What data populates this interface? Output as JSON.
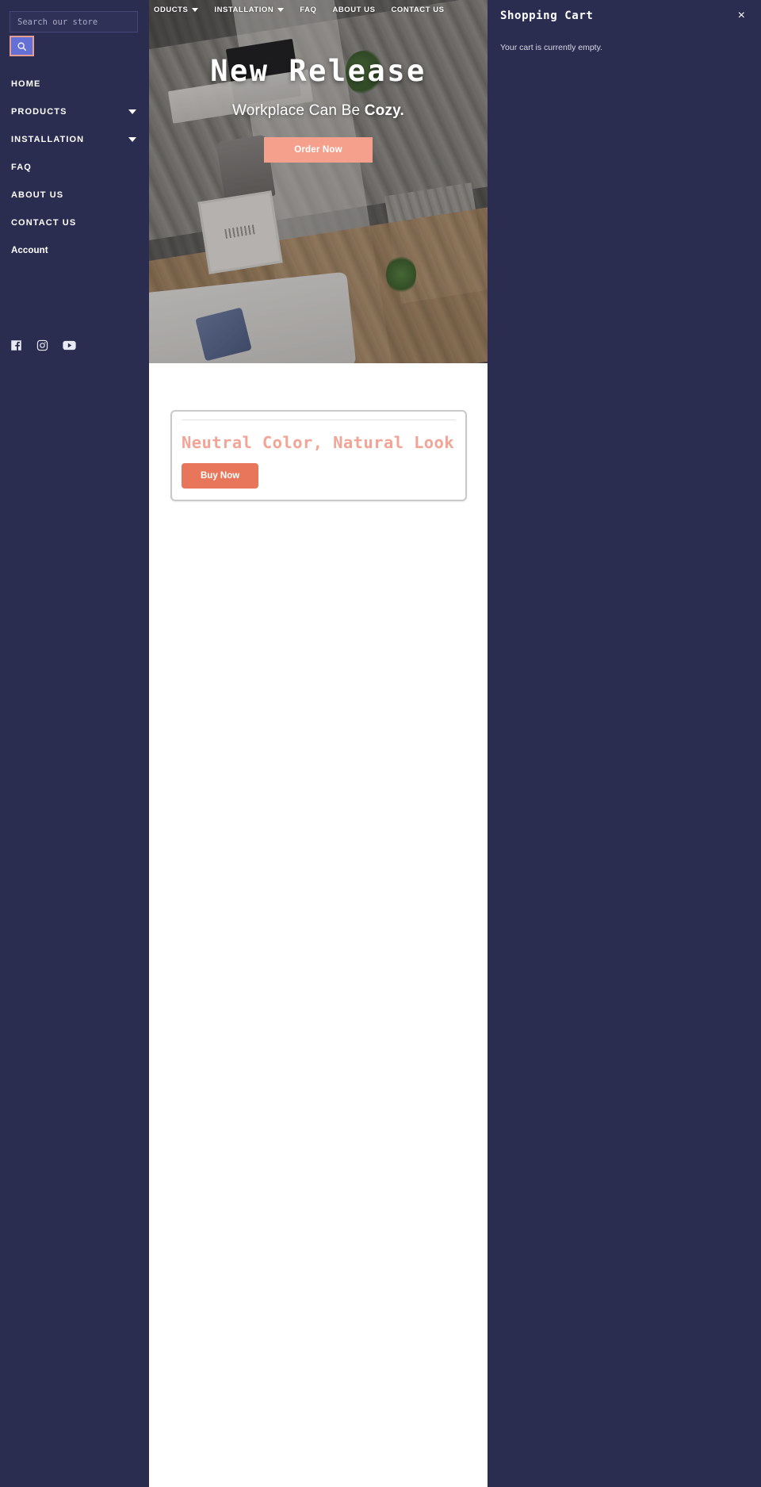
{
  "sidebar": {
    "search": {
      "placeholder": "Search our store",
      "value": "",
      "button_icon": "search-icon"
    },
    "items": [
      {
        "label": "HOME",
        "has_caret": false
      },
      {
        "label": "PRODUCTS",
        "has_caret": true
      },
      {
        "label": "INSTALLATION",
        "has_caret": true
      },
      {
        "label": "FAQ",
        "has_caret": false
      },
      {
        "label": "ABOUT US",
        "has_caret": false
      },
      {
        "label": "CONTACT US",
        "has_caret": false
      },
      {
        "label": "Account",
        "has_caret": false
      }
    ],
    "socials": [
      {
        "name": "facebook-icon"
      },
      {
        "name": "instagram-icon"
      },
      {
        "name": "youtube-icon"
      }
    ]
  },
  "topnav": {
    "items": [
      {
        "label": "ODUCTS",
        "has_caret": true
      },
      {
        "label": "INSTALLATION",
        "has_caret": true
      },
      {
        "label": "FAQ",
        "has_caret": false
      },
      {
        "label": "ABOUT US",
        "has_caret": false
      },
      {
        "label": "CONTACT US",
        "has_caret": false
      }
    ]
  },
  "hero": {
    "title": "New Release",
    "subtitle_plain": "Workplace Can Be ",
    "subtitle_bold": "Cozy.",
    "cta_label": "Order Now"
  },
  "product_card": {
    "title": "Neutral Color, Natural Look",
    "cta_label": "Buy Now"
  },
  "cart": {
    "title": "Shopping Cart",
    "close_label": "×",
    "empty_message": "Your cart is currently empty."
  },
  "colors": {
    "sidebar_bg": "#2a2d4f",
    "accent_coral": "#e8765a",
    "accent_salmon": "#f4a08c",
    "card_title": "#f2a496",
    "search_button": "#6470d6",
    "page_bg": "#ffffff"
  }
}
